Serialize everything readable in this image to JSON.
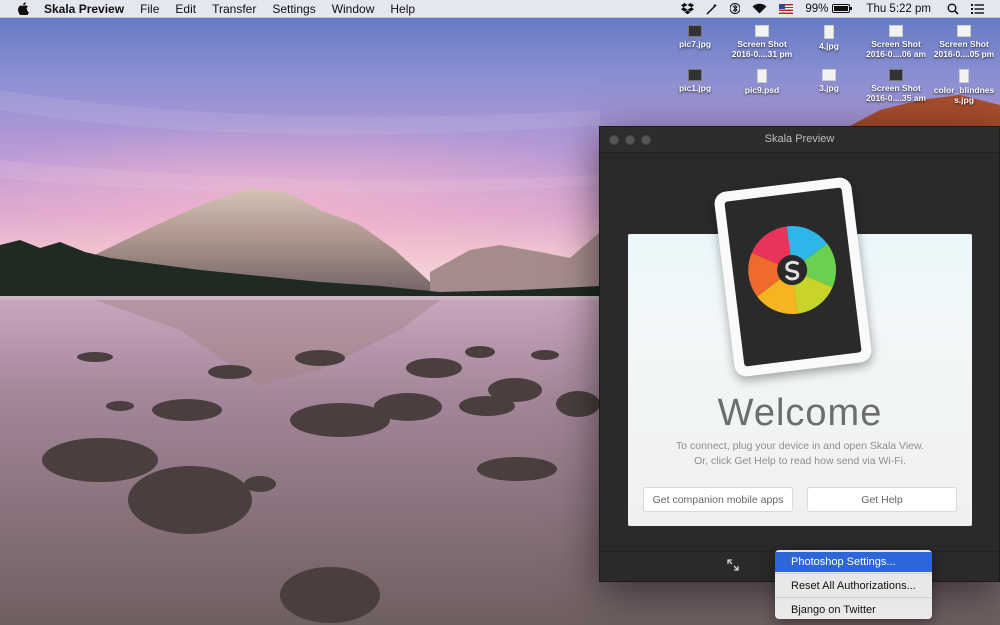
{
  "menubar": {
    "app_name": "Skala Preview",
    "items": [
      "File",
      "Edit",
      "Transfer",
      "Settings",
      "Window",
      "Help"
    ],
    "battery": "99%",
    "clock": "Thu 5:22 pm",
    "status_icons": [
      "dropbox-icon",
      "wand-icon",
      "bluetooth-icon",
      "wifi-icon",
      "flag-icon",
      "battery-icon",
      "search-icon",
      "list-icon"
    ]
  },
  "desktop_icons": [
    {
      "name": "pic7.jpg",
      "line2": ""
    },
    {
      "name": "Screen Shot",
      "line2": "2016-0....31 pm"
    },
    {
      "name": "4.jpg",
      "line2": ""
    },
    {
      "name": "Screen Shot",
      "line2": "2016-0....06 am"
    },
    {
      "name": "Screen Shot",
      "line2": "2016-0....05 pm"
    },
    {
      "name": "pic1.jpg",
      "line2": ""
    },
    {
      "name": "pic9.psd",
      "line2": ""
    },
    {
      "name": "3.jpg",
      "line2": ""
    },
    {
      "name": "Screen Shot",
      "line2": "2016-0....35 am"
    },
    {
      "name": "color_blindnes",
      "line2": "s.jpg"
    }
  ],
  "window": {
    "title": "Skala Preview",
    "welcome": "Welcome",
    "description_line1": "To connect, plug your device in and open Skala View.",
    "description_line2": "Or, click Get Help to read how send via Wi-Fi.",
    "btn_companion": "Get companion mobile apps",
    "btn_help": "Get Help"
  },
  "popup_menu": {
    "items": [
      "Photoshop Settings...",
      "Reset All Authorizations...",
      "Bjango on Twitter"
    ],
    "selected_index": 0
  },
  "colors": {
    "menu_highlight": "#2d66d9",
    "window_bg": "#2a2a2b"
  }
}
